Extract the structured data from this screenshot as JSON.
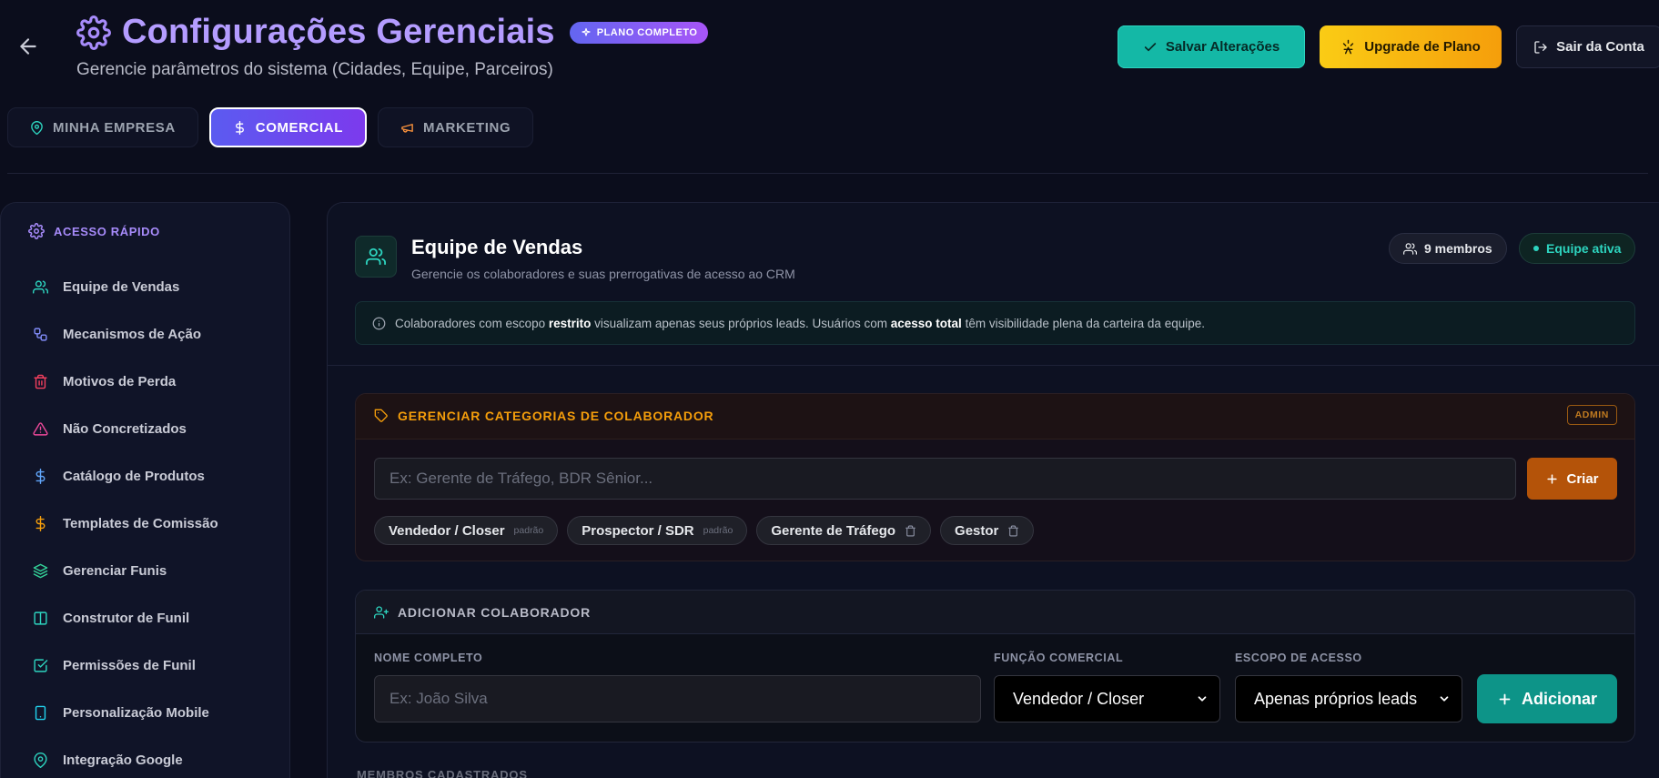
{
  "header": {
    "title": "Configurações Gerenciais",
    "plan_badge": "PLANO COMPLETO",
    "subtitle": "Gerencie parâmetros do sistema (Cidades, Equipe, Parceiros)",
    "buttons": {
      "save": "Salvar Alterações",
      "upgrade": "Upgrade de Plano",
      "logout": "Sair da Conta"
    }
  },
  "tabs": [
    {
      "label": "MINHA EMPRESA",
      "icon": "map-pin-icon"
    },
    {
      "label": "COMERCIAL",
      "icon": "dollar-icon",
      "active": true
    },
    {
      "label": "MARKETING",
      "icon": "megaphone-icon"
    }
  ],
  "sidebar": {
    "heading": "ACESSO RÁPIDO",
    "items": [
      {
        "label": "Equipe de Vendas",
        "icon": "users-icon",
        "color": "#2dd4bf"
      },
      {
        "label": "Mecanismos de Ação",
        "icon": "workflow-icon",
        "color": "#818cf8"
      },
      {
        "label": "Motivos de Perda",
        "icon": "trash-icon",
        "color": "#f43f5e"
      },
      {
        "label": "Não Concretizados",
        "icon": "alert-triangle-icon",
        "color": "#ec4899"
      },
      {
        "label": "Catálogo de Produtos",
        "icon": "dollar-icon",
        "color": "#60a5fa"
      },
      {
        "label": "Templates de Comissão",
        "icon": "dollar-icon",
        "color": "#f59e0b"
      },
      {
        "label": "Gerenciar Funis",
        "icon": "layers-icon",
        "color": "#34d399"
      },
      {
        "label": "Construtor de Funil",
        "icon": "columns-icon",
        "color": "#2dd4bf"
      },
      {
        "label": "Permissões de Funil",
        "icon": "check-square-icon",
        "color": "#2dd4bf"
      },
      {
        "label": "Personalização Mobile",
        "icon": "smartphone-icon",
        "color": "#22d3ee"
      },
      {
        "label": "Integração Google",
        "icon": "map-pin-icon",
        "color": "#2dd4bf"
      }
    ]
  },
  "team": {
    "title": "Equipe de Vendas",
    "subtitle": "Gerencie os colaboradores e suas prerrogativas de acesso ao CRM",
    "members_pill": "9 membros",
    "active_pill": "Equipe ativa",
    "info": {
      "part1": "Colaboradores com escopo ",
      "bold1": "restrito",
      "part2": " visualizam apenas seus próprios leads. Usuários com ",
      "bold2": "acesso total",
      "part3": " têm visibilidade plena da carteira da equipe."
    }
  },
  "categories": {
    "title": "GERENCIAR CATEGORIAS DE COLABORADOR",
    "admin_badge": "ADMIN",
    "input_placeholder": "Ex: Gerente de Tráfego, BDR Sênior...",
    "create_button": "Criar",
    "chips": [
      {
        "label": "Vendedor / Closer",
        "tag": "padrão"
      },
      {
        "label": "Prospector / SDR",
        "tag": "padrão"
      },
      {
        "label": "Gerente de Tráfego",
        "deletable": true
      },
      {
        "label": "Gestor",
        "deletable": true
      }
    ]
  },
  "add_collaborator": {
    "title": "ADICIONAR COLABORADOR",
    "name_label": "NOME COMPLETO",
    "name_placeholder": "Ex: João Silva",
    "role_label": "FUNÇÃO COMERCIAL",
    "role_value": "Vendedor / Closer",
    "scope_label": "ESCOPO DE ACESSO",
    "scope_value": "Apenas próprios leads",
    "add_button": "Adicionar"
  },
  "members_section": {
    "label": "MEMBROS CADASTRADOS"
  }
}
